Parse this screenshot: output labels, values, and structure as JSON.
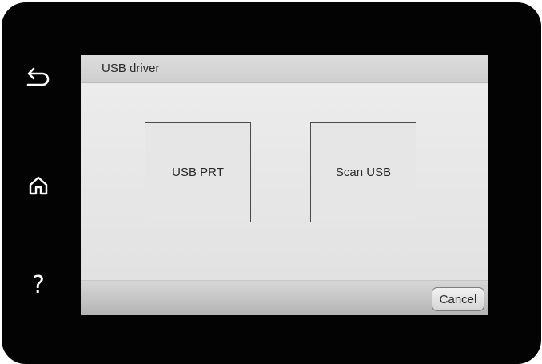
{
  "side_buttons": {
    "back_icon": "back-arrow-icon",
    "home_icon": "home-icon",
    "help_glyph": "?"
  },
  "screen": {
    "title": "USB driver",
    "tiles": [
      {
        "label": "USB PRT"
      },
      {
        "label": "Scan USB"
      }
    ],
    "cancel_label": "Cancel"
  },
  "colors": {
    "bezel": "#030303",
    "screen_bg": "#e4e4e4",
    "icon": "#ffffff"
  }
}
